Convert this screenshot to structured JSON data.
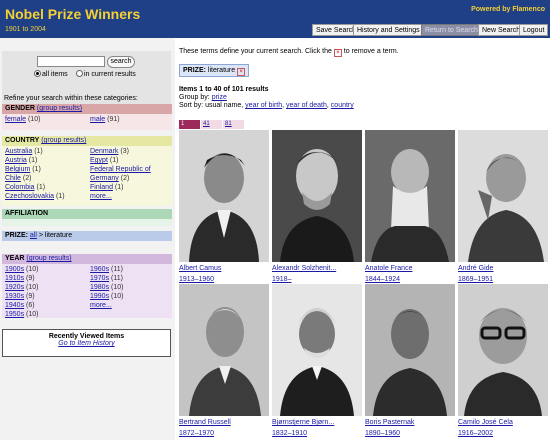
{
  "header": {
    "title": "Nobel Prize Winners",
    "subtitle": "1901 to 2004",
    "powered_by": "Powered by Flamenco",
    "buttons": [
      "Save Search",
      "History and Settings",
      "Return to Search",
      "New Search",
      "Logout"
    ]
  },
  "search": {
    "button_label": "search",
    "input_value": "",
    "option_all": "all items",
    "option_current": "in current results",
    "refine_label": "Refine your search within these categories:"
  },
  "facets": {
    "gender": {
      "title": "GENDER",
      "group_link": "(group results)",
      "items": [
        {
          "label": "female",
          "count": "(10)"
        },
        {
          "label": "male",
          "count": "(91)"
        }
      ]
    },
    "country": {
      "title": "COUNTRY",
      "group_link": "(group results)",
      "col1": [
        {
          "label": "Australia",
          "count": "(1)"
        },
        {
          "label": "Austria",
          "count": "(1)"
        },
        {
          "label": "Belgium",
          "count": "(1)"
        },
        {
          "label": "Chile",
          "count": "(2)"
        },
        {
          "label": "Colombia",
          "count": "(1)"
        },
        {
          "label": "Czechoslovakia",
          "count": "(1)"
        }
      ],
      "col2": [
        {
          "label": "Denmark",
          "count": "(3)"
        },
        {
          "label": "Egypt",
          "count": "(1)"
        },
        {
          "label": "Federal Republic of",
          "count": ""
        },
        {
          "label": "Germany",
          "count": "(2)"
        },
        {
          "label": "Finland",
          "count": "(1)"
        },
        {
          "label": "more...",
          "count": ""
        }
      ]
    },
    "affiliation": {
      "title": "AFFILIATION"
    },
    "prize": {
      "title": "PRIZE:",
      "all_link": "all",
      "current": "> literature"
    },
    "year": {
      "title": "YEAR",
      "group_link": "(group results)",
      "col1": [
        {
          "label": "1900s",
          "count": "(10)"
        },
        {
          "label": "1910s",
          "count": "(9)"
        },
        {
          "label": "1920s",
          "count": "(10)"
        },
        {
          "label": "1930s",
          "count": "(9)"
        },
        {
          "label": "1940s",
          "count": "(6)"
        },
        {
          "label": "1950s",
          "count": "(10)"
        }
      ],
      "col2": [
        {
          "label": "1960s",
          "count": "(11)"
        },
        {
          "label": "1970s",
          "count": "(11)"
        },
        {
          "label": "1980s",
          "count": "(10)"
        },
        {
          "label": "1990s",
          "count": "(10)"
        },
        {
          "label": "more...",
          "count": ""
        }
      ]
    }
  },
  "recent": {
    "title": "Recently Viewed Items",
    "link": "Go to Item History"
  },
  "main": {
    "terms_message_before": "These terms define your current search. Click the",
    "terms_message_after": "to remove a term.",
    "remove_symbol": "×",
    "term_label": "PRIZE:",
    "term_value": "literature",
    "results_count": "Items 1 to 40 of 101 results",
    "group_by_label": "Group by:",
    "group_by_value": "prize",
    "sort_by_label": "Sort by:",
    "sort_by_current": "usual name,",
    "sort_options": [
      "year of birth",
      "year of death",
      "country"
    ],
    "pages": [
      "1",
      "41",
      "81"
    ]
  },
  "results": [
    {
      "name": "Albert Camus",
      "years": "1913–1960"
    },
    {
      "name": "Alexandr Solzhenit...",
      "years": "1918–"
    },
    {
      "name": "Anatole France",
      "years": "1844–1924"
    },
    {
      "name": "André Gide",
      "years": "1869–1951"
    },
    {
      "name": "Bertrand Russell",
      "years": "1872–1970"
    },
    {
      "name": "Bjørnstjerne Bjørn...",
      "years": "1832–1910"
    },
    {
      "name": "Boris Pasternak",
      "years": "1890–1960"
    },
    {
      "name": "Camilo José Cela",
      "years": "1916–2002"
    }
  ]
}
